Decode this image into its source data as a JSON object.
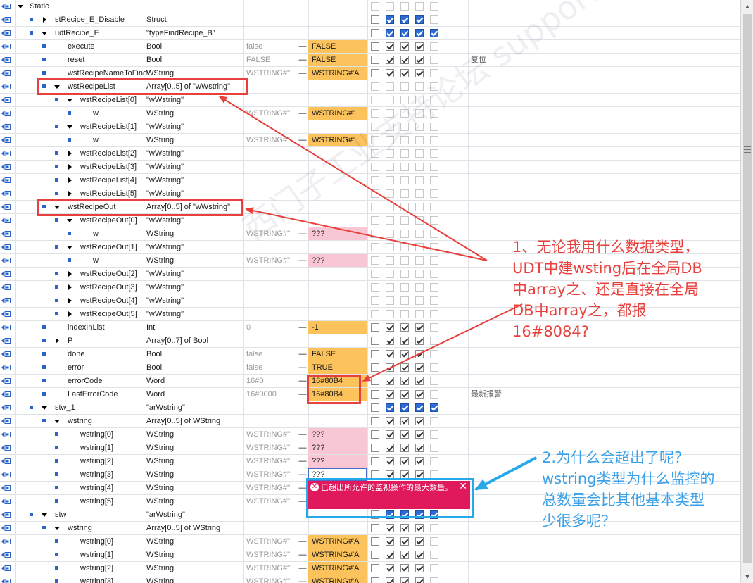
{
  "rows": [
    {
      "indent": 0,
      "expand": "down",
      "bullet": false,
      "name": "Static",
      "type": "",
      "start": "",
      "dash": "",
      "mon": "",
      "mon_style": "",
      "cbs": [
        0,
        0,
        0,
        0,
        0
      ],
      "comment": ""
    },
    {
      "indent": 1,
      "expand": "right",
      "bullet": true,
      "name": "stRecipe_E_Disable",
      "type": "Struct",
      "start": "",
      "dash": "",
      "mon": "",
      "mon_style": "",
      "cbs": [
        1,
        3,
        3,
        3,
        0
      ],
      "comment": ""
    },
    {
      "indent": 1,
      "expand": "down",
      "bullet": true,
      "name": "udtRecipe_E",
      "type": "\"typeFindRecipe_B\"",
      "start": "",
      "dash": "",
      "mon": "",
      "mon_style": "",
      "cbs": [
        1,
        3,
        3,
        3,
        3
      ],
      "comment": ""
    },
    {
      "indent": 2,
      "expand": "",
      "bullet": true,
      "name": "execute",
      "type": "Bool",
      "start": "false",
      "dash": "—",
      "mon": "FALSE",
      "mon_style": "orange",
      "cbs": [
        1,
        2,
        2,
        2,
        0
      ],
      "comment": ""
    },
    {
      "indent": 2,
      "expand": "",
      "bullet": true,
      "name": "reset",
      "type": "Bool",
      "start": "FALSE",
      "dash": "—",
      "mon": "FALSE",
      "mon_style": "orange",
      "cbs": [
        1,
        2,
        2,
        2,
        0
      ],
      "comment": "复位"
    },
    {
      "indent": 2,
      "expand": "",
      "bullet": true,
      "name": "wstRecipeNameToFind",
      "type": "WString",
      "start": "WSTRING#''",
      "dash": "—",
      "mon": "WSTRING#'A'",
      "mon_style": "orange",
      "cbs": [
        1,
        2,
        2,
        2,
        0
      ],
      "comment": ""
    },
    {
      "indent": 2,
      "expand": "down",
      "bullet": true,
      "name": "wstRecipeList",
      "type": "Array[0..5] of \"wWstring\"",
      "start": "",
      "dash": "",
      "mon": "",
      "mon_style": "",
      "cbs": [
        0,
        0,
        0,
        0,
        0
      ],
      "comment": ""
    },
    {
      "indent": 3,
      "expand": "down",
      "bullet": true,
      "name": "wstRecipeList[0]",
      "type": "\"wWstring\"",
      "start": "",
      "dash": "",
      "mon": "",
      "mon_style": "",
      "cbs": [
        0,
        0,
        0,
        0,
        0
      ],
      "comment": ""
    },
    {
      "indent": 4,
      "expand": "",
      "bullet": true,
      "name": "w",
      "type": "WString",
      "start": "WSTRING#''",
      "dash": "—",
      "mon": "WSTRING#''",
      "mon_style": "orange",
      "cbs": [
        0,
        0,
        0,
        0,
        0
      ],
      "comment": ""
    },
    {
      "indent": 3,
      "expand": "down",
      "bullet": true,
      "name": "wstRecipeList[1]",
      "type": "\"wWstring\"",
      "start": "",
      "dash": "",
      "mon": "",
      "mon_style": "",
      "cbs": [
        0,
        0,
        0,
        0,
        0
      ],
      "comment": ""
    },
    {
      "indent": 4,
      "expand": "",
      "bullet": true,
      "name": "w",
      "type": "WString",
      "start": "WSTRING#''",
      "dash": "—",
      "mon": "WSTRING#''",
      "mon_style": "orange",
      "cbs": [
        0,
        0,
        0,
        0,
        0
      ],
      "comment": ""
    },
    {
      "indent": 3,
      "expand": "right",
      "bullet": true,
      "name": "wstRecipeList[2]",
      "type": "\"wWstring\"",
      "start": "",
      "dash": "",
      "mon": "",
      "mon_style": "",
      "cbs": [
        0,
        0,
        0,
        0,
        0
      ],
      "comment": ""
    },
    {
      "indent": 3,
      "expand": "right",
      "bullet": true,
      "name": "wstRecipeList[3]",
      "type": "\"wWstring\"",
      "start": "",
      "dash": "",
      "mon": "",
      "mon_style": "",
      "cbs": [
        0,
        0,
        0,
        0,
        0
      ],
      "comment": ""
    },
    {
      "indent": 3,
      "expand": "right",
      "bullet": true,
      "name": "wstRecipeList[4]",
      "type": "\"wWstring\"",
      "start": "",
      "dash": "",
      "mon": "",
      "mon_style": "",
      "cbs": [
        0,
        0,
        0,
        0,
        0
      ],
      "comment": ""
    },
    {
      "indent": 3,
      "expand": "right",
      "bullet": true,
      "name": "wstRecipeList[5]",
      "type": "\"wWstring\"",
      "start": "",
      "dash": "",
      "mon": "",
      "mon_style": "",
      "cbs": [
        0,
        0,
        0,
        0,
        0
      ],
      "comment": ""
    },
    {
      "indent": 2,
      "expand": "down",
      "bullet": true,
      "name": "wstRecipeOut",
      "type": "Array[0..5] of \"wWstring\"",
      "start": "",
      "dash": "",
      "mon": "",
      "mon_style": "",
      "cbs": [
        0,
        0,
        0,
        0,
        0
      ],
      "comment": ""
    },
    {
      "indent": 3,
      "expand": "down",
      "bullet": true,
      "name": "wstRecipeOut[0]",
      "type": "\"wWstring\"",
      "start": "",
      "dash": "",
      "mon": "",
      "mon_style": "",
      "cbs": [
        0,
        0,
        0,
        0,
        0
      ],
      "comment": ""
    },
    {
      "indent": 4,
      "expand": "",
      "bullet": true,
      "name": "w",
      "type": "WString",
      "start": "WSTRING#''",
      "dash": "—",
      "mon": "???",
      "mon_style": "pink",
      "cbs": [
        0,
        0,
        0,
        0,
        0
      ],
      "comment": ""
    },
    {
      "indent": 3,
      "expand": "down",
      "bullet": true,
      "name": "wstRecipeOut[1]",
      "type": "\"wWstring\"",
      "start": "",
      "dash": "",
      "mon": "",
      "mon_style": "",
      "cbs": [
        0,
        0,
        0,
        0,
        0
      ],
      "comment": ""
    },
    {
      "indent": 4,
      "expand": "",
      "bullet": true,
      "name": "w",
      "type": "WString",
      "start": "WSTRING#''",
      "dash": "—",
      "mon": "???",
      "mon_style": "pink",
      "cbs": [
        0,
        0,
        0,
        0,
        0
      ],
      "comment": ""
    },
    {
      "indent": 3,
      "expand": "right",
      "bullet": true,
      "name": "wstRecipeOut[2]",
      "type": "\"wWstring\"",
      "start": "",
      "dash": "",
      "mon": "",
      "mon_style": "",
      "cbs": [
        0,
        0,
        0,
        0,
        0
      ],
      "comment": ""
    },
    {
      "indent": 3,
      "expand": "right",
      "bullet": true,
      "name": "wstRecipeOut[3]",
      "type": "\"wWstring\"",
      "start": "",
      "dash": "",
      "mon": "",
      "mon_style": "",
      "cbs": [
        0,
        0,
        0,
        0,
        0
      ],
      "comment": ""
    },
    {
      "indent": 3,
      "expand": "right",
      "bullet": true,
      "name": "wstRecipeOut[4]",
      "type": "\"wWstring\"",
      "start": "",
      "dash": "",
      "mon": "",
      "mon_style": "",
      "cbs": [
        0,
        0,
        0,
        0,
        0
      ],
      "comment": ""
    },
    {
      "indent": 3,
      "expand": "right",
      "bullet": true,
      "name": "wstRecipeOut[5]",
      "type": "\"wWstring\"",
      "start": "",
      "dash": "",
      "mon": "",
      "mon_style": "",
      "cbs": [
        0,
        0,
        0,
        0,
        0
      ],
      "comment": ""
    },
    {
      "indent": 2,
      "expand": "",
      "bullet": true,
      "name": "indexInList",
      "type": "Int",
      "start": "0",
      "dash": "—",
      "mon": "-1",
      "mon_style": "orange",
      "cbs": [
        1,
        2,
        2,
        2,
        0
      ],
      "comment": ""
    },
    {
      "indent": 2,
      "expand": "right",
      "bullet": true,
      "name": "P",
      "type": "Array[0..7] of Bool",
      "start": "",
      "dash": "",
      "mon": "",
      "mon_style": "",
      "cbs": [
        1,
        2,
        2,
        2,
        0
      ],
      "comment": ""
    },
    {
      "indent": 2,
      "expand": "",
      "bullet": true,
      "name": "done",
      "type": "Bool",
      "start": "false",
      "dash": "—",
      "mon": "FALSE",
      "mon_style": "orange",
      "cbs": [
        1,
        2,
        2,
        2,
        0
      ],
      "comment": ""
    },
    {
      "indent": 2,
      "expand": "",
      "bullet": true,
      "name": "error",
      "type": "Bool",
      "start": "false",
      "dash": "—",
      "mon": "TRUE",
      "mon_style": "orange",
      "cbs": [
        1,
        2,
        2,
        2,
        0
      ],
      "comment": ""
    },
    {
      "indent": 2,
      "expand": "",
      "bullet": true,
      "name": "errorCode",
      "type": "Word",
      "start": "16#0",
      "dash": "—",
      "mon": "16#80B4",
      "mon_style": "orange",
      "cbs": [
        1,
        2,
        2,
        2,
        0
      ],
      "comment": ""
    },
    {
      "indent": 2,
      "expand": "",
      "bullet": true,
      "name": "LastErrorCode",
      "type": "Word",
      "start": "16#0000",
      "dash": "—",
      "mon": "16#80B4",
      "mon_style": "orange",
      "cbs": [
        1,
        2,
        2,
        2,
        0
      ],
      "comment": "最新报警"
    },
    {
      "indent": 1,
      "expand": "down",
      "bullet": true,
      "name": "stw_1",
      "type": "\"arWstring\"",
      "start": "",
      "dash": "",
      "mon": "",
      "mon_style": "",
      "cbs": [
        1,
        3,
        3,
        3,
        3
      ],
      "comment": ""
    },
    {
      "indent": 2,
      "expand": "down",
      "bullet": true,
      "name": "wstring",
      "type": "Array[0..5] of WString",
      "start": "",
      "dash": "",
      "mon": "",
      "mon_style": "",
      "cbs": [
        1,
        2,
        2,
        2,
        0
      ],
      "comment": ""
    },
    {
      "indent": 3,
      "expand": "",
      "bullet": true,
      "name": "wstring[0]",
      "type": "WString",
      "start": "WSTRING#''",
      "dash": "—",
      "mon": "???",
      "mon_style": "pink",
      "cbs": [
        1,
        2,
        2,
        2,
        0
      ],
      "comment": ""
    },
    {
      "indent": 3,
      "expand": "",
      "bullet": true,
      "name": "wstring[1]",
      "type": "WString",
      "start": "WSTRING#''",
      "dash": "—",
      "mon": "???",
      "mon_style": "pink",
      "cbs": [
        1,
        2,
        2,
        2,
        0
      ],
      "comment": ""
    },
    {
      "indent": 3,
      "expand": "",
      "bullet": true,
      "name": "wstring[2]",
      "type": "WString",
      "start": "WSTRING#''",
      "dash": "—",
      "mon": "???",
      "mon_style": "pink",
      "cbs": [
        1,
        2,
        2,
        2,
        0
      ],
      "comment": ""
    },
    {
      "indent": 3,
      "expand": "",
      "bullet": true,
      "name": "wstring[3]",
      "type": "WString",
      "start": "WSTRING#''",
      "dash": "—",
      "mon": "???",
      "mon_style": "outlined",
      "cbs": [
        1,
        2,
        2,
        2,
        0
      ],
      "comment": ""
    },
    {
      "indent": 3,
      "expand": "",
      "bullet": true,
      "name": "wstring[4]",
      "type": "WString",
      "start": "WSTRING#''",
      "dash": "—",
      "mon": "",
      "mon_style": "",
      "cbs": [
        1,
        2,
        2,
        2,
        0
      ],
      "comment": ""
    },
    {
      "indent": 3,
      "expand": "",
      "bullet": true,
      "name": "wstring[5]",
      "type": "WString",
      "start": "WSTRING#''",
      "dash": "—",
      "mon": "",
      "mon_style": "",
      "cbs": [
        1,
        2,
        2,
        2,
        0
      ],
      "comment": ""
    },
    {
      "indent": 1,
      "expand": "down",
      "bullet": true,
      "name": "stw",
      "type": "\"arWstring\"",
      "start": "",
      "dash": "",
      "mon": "",
      "mon_style": "",
      "cbs": [
        1,
        3,
        3,
        3,
        3
      ],
      "comment": ""
    },
    {
      "indent": 2,
      "expand": "down",
      "bullet": true,
      "name": "wstring",
      "type": "Array[0..5] of WString",
      "start": "",
      "dash": "",
      "mon": "",
      "mon_style": "",
      "cbs": [
        1,
        2,
        2,
        2,
        0
      ],
      "comment": ""
    },
    {
      "indent": 3,
      "expand": "",
      "bullet": true,
      "name": "wstring[0]",
      "type": "WString",
      "start": "WSTRING#''",
      "dash": "—",
      "mon": "WSTRING#'A'",
      "mon_style": "orange",
      "cbs": [
        1,
        2,
        2,
        2,
        0
      ],
      "comment": ""
    },
    {
      "indent": 3,
      "expand": "",
      "bullet": true,
      "name": "wstring[1]",
      "type": "WString",
      "start": "WSTRING#''",
      "dash": "—",
      "mon": "WSTRING#'A'",
      "mon_style": "orange",
      "cbs": [
        1,
        2,
        2,
        2,
        0
      ],
      "comment": ""
    },
    {
      "indent": 3,
      "expand": "",
      "bullet": true,
      "name": "wstring[2]",
      "type": "WString",
      "start": "WSTRING#''",
      "dash": "—",
      "mon": "WSTRING#'A'",
      "mon_style": "orange",
      "cbs": [
        1,
        2,
        2,
        2,
        0
      ],
      "comment": ""
    },
    {
      "indent": 3,
      "expand": "",
      "bullet": true,
      "name": "wstring[3]",
      "type": "WString",
      "start": "WSTRING#''",
      "dash": "—",
      "mon": "WSTRING#'A'",
      "mon_style": "orange",
      "cbs": [
        1,
        2,
        2,
        2,
        0
      ],
      "comment": ""
    }
  ],
  "annotation1": {
    "lines": [
      "1、无论我用什么数据类型，",
      "UDT中建wsting后在全局DB",
      "中array之、还是直接在全局",
      "DB中array之，都报",
      "16#8084?"
    ]
  },
  "annotation2": {
    "lines": [
      "2.为什么会超出了呢？",
      "wstring类型为什么监控的",
      "总数量会比其他基本类型",
      "少很多呢？"
    ]
  },
  "error_popup": {
    "message": "已超出所允许的监视操作的最大数量。",
    "close": "✕"
  },
  "watermark": "西门子工业支持论坛 support.industry.siemens.com.cn",
  "colors": {
    "monitor_orange": "#fcc35c",
    "monitor_pink": "#f9c6d3",
    "annotation_red": "#e8413d",
    "annotation_blue": "#3aa0e8",
    "error_popup": "#e0195c",
    "checkbox_blue": "#2e6bd5"
  },
  "icons": [
    "db-member-icon",
    "bullet-icon",
    "expand-arrow-icon",
    "collapse-arrow-icon",
    "checkbox-icon",
    "error-icon",
    "close-icon",
    "scroll-up-icon",
    "scroll-down-icon"
  ]
}
